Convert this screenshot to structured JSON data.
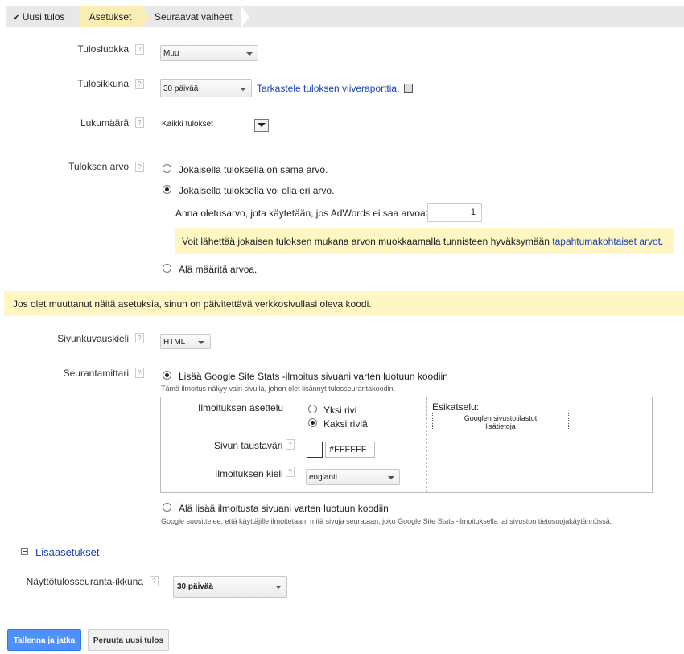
{
  "breadcrumb": {
    "items": [
      "Uusi tulos",
      "Asetukset",
      "Seuraavat vaiheet"
    ]
  },
  "category": {
    "label": "Tulosluokka",
    "value": "Muu"
  },
  "window": {
    "label": "Tulosikkuna",
    "value": "30 päivää",
    "link": "Tarkastele tuloksen viiveraporttia."
  },
  "count": {
    "label": "Lukumäärä",
    "value": "Kaikki tulokset"
  },
  "value": {
    "label": "Tuloksen arvo",
    "option_same": "Jokaisella tuloksella on sama arvo.",
    "option_diff": "Jokaisella tuloksella voi olla eri arvo.",
    "default_label": "Anna oletusarvo, jota käytetään, jos AdWords ei saa arvoa:",
    "default_value": "1",
    "info_text": "Voit lähettää jokaisen tuloksen mukana arvon muokkaamalla tunnisteen hyväksymään ",
    "info_link": "tapahtumakohtaiset arvot",
    "info_end": ".",
    "option_none": "Älä määritä arvoa."
  },
  "notice": "Jos olet muuttanut näitä asetuksia, sinun on päivitettävä verkkosivullasi oleva koodi.",
  "markup": {
    "label": "Sivunkuvauskieli",
    "value": "HTML"
  },
  "tracking": {
    "label": "Seurantamittari",
    "option_add": "Lisää Google Site Stats -ilmoitus sivuani varten luotuun koodiin",
    "option_add_note": "Tämä ilmoitus näkyy vain sivulla, johon olet lisännyt tulosseurantakoodin.",
    "layout_label": "Ilmoituksen asettelu",
    "layout_one": "Yksi rivi",
    "layout_two": "Kaksi riviä",
    "bg_label": "Sivun taustaväri",
    "bg_value": "#FFFFFF",
    "lang_label": "Ilmoituksen kieli",
    "lang_value": "englanti",
    "preview_label": "Esikatselu:",
    "preview_line1": "Googlen sivustotilastot",
    "preview_line2": "lisätietoja",
    "option_skip": "Älä lisää ilmoitusta sivuani varten luotuun koodiin",
    "option_skip_note": "Google suosittelee, että käyttäjille ilmoitetaan, mitä sivuja seurataan, joko Google Site Stats -ilmoituksella tai sivuston tietosuojakäytännössä."
  },
  "advanced": {
    "toggle": "Lisäasetukset",
    "view_label": "Näyttötulosseuranta-ikkuna",
    "view_value": "30 päivää"
  },
  "buttons": {
    "save": "Tallenna ja jatka",
    "cancel": "Peruuta uusi tulos"
  },
  "colors": {
    "accent": "#4d90fe",
    "notice_bg": "#fff6c4",
    "link": "#1a44b5"
  }
}
